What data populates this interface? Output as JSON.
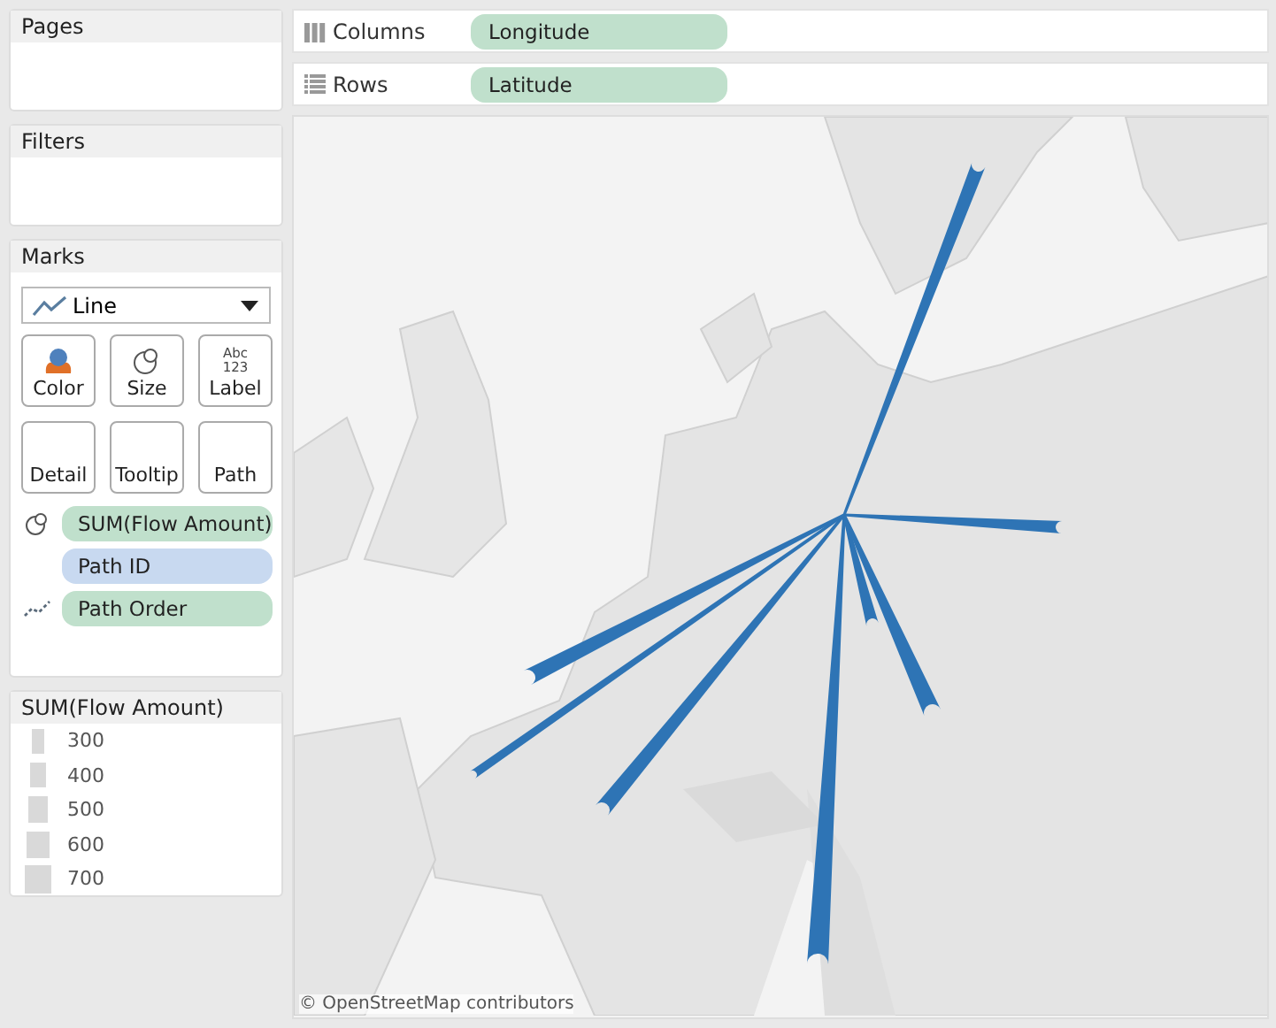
{
  "pages": {
    "title": "Pages"
  },
  "filters": {
    "title": "Filters"
  },
  "marks": {
    "title": "Marks",
    "mark_type": "Line",
    "cards": [
      {
        "kind": "color",
        "label": "Color"
      },
      {
        "kind": "size",
        "label": "Size"
      },
      {
        "kind": "label",
        "label": "Label",
        "icon_text": "Abc\n123"
      },
      {
        "kind": "plain",
        "label": "Detail"
      },
      {
        "kind": "plain",
        "label": "Tooltip"
      },
      {
        "kind": "plain",
        "label": "Path"
      }
    ],
    "pills": [
      {
        "label": "SUM(Flow Amount)",
        "kind": "size",
        "color": "#c0e0cc"
      },
      {
        "label": "Path ID",
        "kind": "none",
        "color": "#c8d9f0"
      },
      {
        "label": "Path Order",
        "kind": "path",
        "color": "#c0e0cc"
      }
    ]
  },
  "legend": {
    "title": "SUM(Flow Amount)",
    "items": [
      "300",
      "400",
      "500",
      "600",
      "700"
    ]
  },
  "shelves": [
    {
      "kind": "columns",
      "label": "Columns",
      "pill": "Longitude"
    },
    {
      "kind": "rows",
      "label": "Rows",
      "pill": "Latitude"
    }
  ],
  "map": {
    "kind": "picture",
    "attribution": "© OpenStreetMap contributors"
  }
}
